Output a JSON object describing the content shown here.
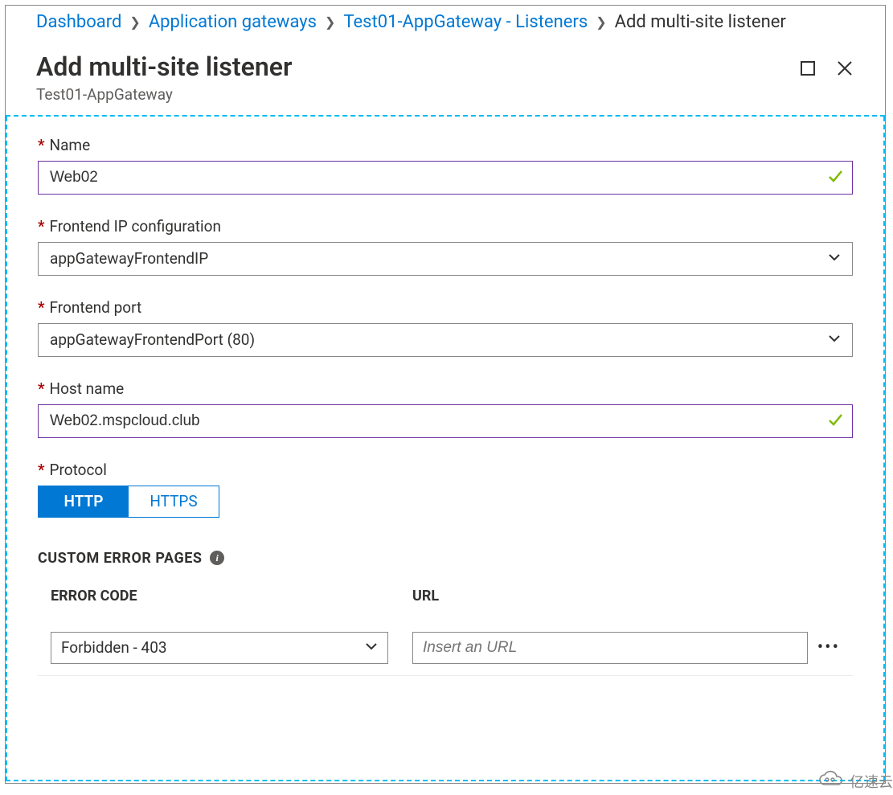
{
  "breadcrumb": {
    "items": [
      {
        "label": "Dashboard",
        "current": false
      },
      {
        "label": "Application gateways",
        "current": false
      },
      {
        "label": "Test01-AppGateway - Listeners",
        "current": false
      },
      {
        "label": "Add multi-site listener",
        "current": true
      }
    ]
  },
  "blade": {
    "title": "Add multi-site listener",
    "subtitle": "Test01-AppGateway"
  },
  "form": {
    "name": {
      "label": "Name",
      "value": "Web02",
      "required": true,
      "valid": true
    },
    "frontend_ip": {
      "label": "Frontend IP configuration",
      "value": "appGatewayFrontendIP",
      "required": true
    },
    "frontend_port": {
      "label": "Frontend port",
      "value": "appGatewayFrontendPort (80)",
      "required": true
    },
    "host_name": {
      "label": "Host name",
      "value": "Web02.mspcloud.club",
      "required": true,
      "valid": true
    },
    "protocol": {
      "label": "Protocol",
      "required": true,
      "options": [
        "HTTP",
        "HTTPS"
      ],
      "selected": "HTTP"
    }
  },
  "custom_error": {
    "section_title": "CUSTOM ERROR PAGES",
    "columns": {
      "code": "ERROR CODE",
      "url": "URL"
    },
    "rows": [
      {
        "code": "Forbidden - 403",
        "url_placeholder": "Insert an URL"
      }
    ]
  },
  "watermark": {
    "text": "亿速云"
  }
}
